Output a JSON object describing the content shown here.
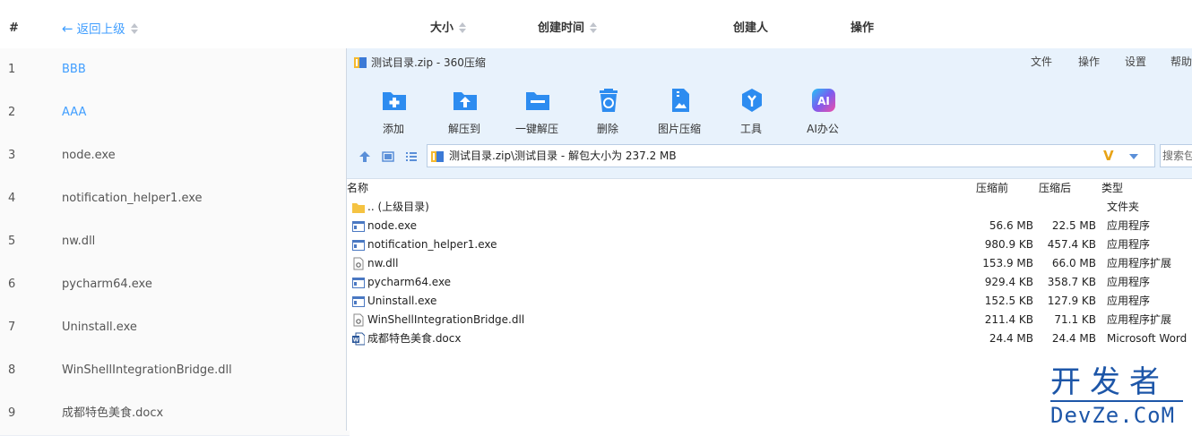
{
  "bg_table": {
    "header": {
      "hash": "#",
      "back": "返回上级",
      "size": "大小",
      "created_time": "创建时间",
      "creator": "创建人",
      "operations": "操作"
    },
    "rows": [
      {
        "idx": "1",
        "name": "BBB",
        "link": true
      },
      {
        "idx": "2",
        "name": "AAA",
        "link": true
      },
      {
        "idx": "3",
        "name": "node.exe",
        "link": false
      },
      {
        "idx": "4",
        "name": "notification_helper1.exe",
        "link": false
      },
      {
        "idx": "5",
        "name": "nw.dll",
        "link": false
      },
      {
        "idx": "6",
        "name": "pycharm64.exe",
        "link": false
      },
      {
        "idx": "7",
        "name": "Uninstall.exe",
        "link": false
      },
      {
        "idx": "8",
        "name": "WinShellIntegrationBridge.dll",
        "link": false
      },
      {
        "idx": "9",
        "name": "成都特色美食.docx",
        "link": false
      }
    ]
  },
  "zip_window": {
    "title": "测试目录.zip - 360压缩",
    "menu": [
      "文件",
      "操作",
      "设置",
      "帮助"
    ],
    "toolbar": [
      {
        "label": "添加",
        "icon": "add-folder-icon"
      },
      {
        "label": "解压到",
        "icon": "extract-to-icon"
      },
      {
        "label": "一键解压",
        "icon": "one-click-extract-icon"
      },
      {
        "label": "删除",
        "icon": "recycle-bin-icon"
      },
      {
        "label": "图片压缩",
        "icon": "image-compress-icon"
      },
      {
        "label": "工具",
        "icon": "tools-icon"
      },
      {
        "label": "AI办公",
        "icon": "ai-office-icon"
      }
    ],
    "address": "测试目录.zip\\测试目录 - 解包大小为 237.2 MB",
    "search_placeholder": "搜索包",
    "columns": {
      "name": "名称",
      "before": "压缩前",
      "after": "压缩后",
      "type": "类型"
    },
    "files": [
      {
        "name": ".. (上级目录)",
        "before": "",
        "after": "",
        "type": "文件夹",
        "icon": "folder-icon"
      },
      {
        "name": "node.exe",
        "before": "56.6 MB",
        "after": "22.5 MB",
        "type": "应用程序",
        "icon": "exe-icon"
      },
      {
        "name": "notification_helper1.exe",
        "before": "980.9 KB",
        "after": "457.4 KB",
        "type": "应用程序",
        "icon": "exe-icon"
      },
      {
        "name": "nw.dll",
        "before": "153.9 MB",
        "after": "66.0 MB",
        "type": "应用程序扩展",
        "icon": "dll-icon"
      },
      {
        "name": "pycharm64.exe",
        "before": "929.4 KB",
        "after": "358.7 KB",
        "type": "应用程序",
        "icon": "exe-icon"
      },
      {
        "name": "Uninstall.exe",
        "before": "152.5 KB",
        "after": "127.9 KB",
        "type": "应用程序",
        "icon": "exe-icon"
      },
      {
        "name": "WinShellIntegrationBridge.dll",
        "before": "211.4 KB",
        "after": "71.1 KB",
        "type": "应用程序扩展",
        "icon": "dll-icon"
      },
      {
        "name": "成都特色美食.docx",
        "before": "24.4 MB",
        "after": "24.4 MB",
        "type": "Microsoft Word",
        "icon": "word-doc-icon"
      }
    ]
  },
  "watermark": {
    "line1": "开发者",
    "line2": "DevZe.CoM"
  },
  "colors": {
    "link": "#409eff",
    "window_bg": "#e8f2fc",
    "icon_blue": "#2d8cf0",
    "watermark": "#1d56a8"
  }
}
